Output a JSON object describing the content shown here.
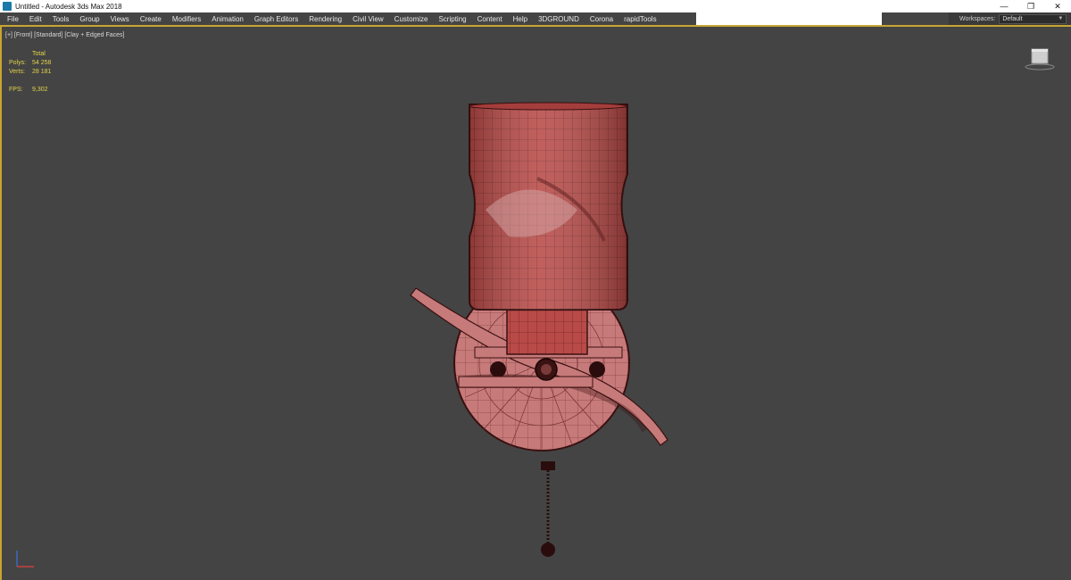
{
  "titlebar": {
    "title": "Untitled - Autodesk 3ds Max 2018",
    "minimize": "—",
    "restore": "❐",
    "close": "✕"
  },
  "menu": {
    "items": [
      "File",
      "Edit",
      "Tools",
      "Group",
      "Views",
      "Create",
      "Modifiers",
      "Animation",
      "Graph Editors",
      "Rendering",
      "Civil View",
      "Customize",
      "Scripting",
      "Content",
      "Help",
      "3DGROUND",
      "Corona",
      "rapidTools"
    ]
  },
  "workspace": {
    "label": "Workspaces:",
    "value": "Default"
  },
  "viewport": {
    "label": "[+] [Front] [Standard] [Clay + Edged Faces]",
    "stats": {
      "header": "Total",
      "polys_label": "Polys:",
      "polys_value": "54 258",
      "verts_label": "Verts:",
      "verts_value": "28 181",
      "fps_label": "FPS:",
      "fps_value": "9,302"
    }
  },
  "colors": {
    "accent_border": "#c8a530",
    "stats_text": "#e3d34a",
    "model_red": "#b84a47",
    "model_pink": "#c77a7a",
    "viewport_bg": "#444444"
  }
}
